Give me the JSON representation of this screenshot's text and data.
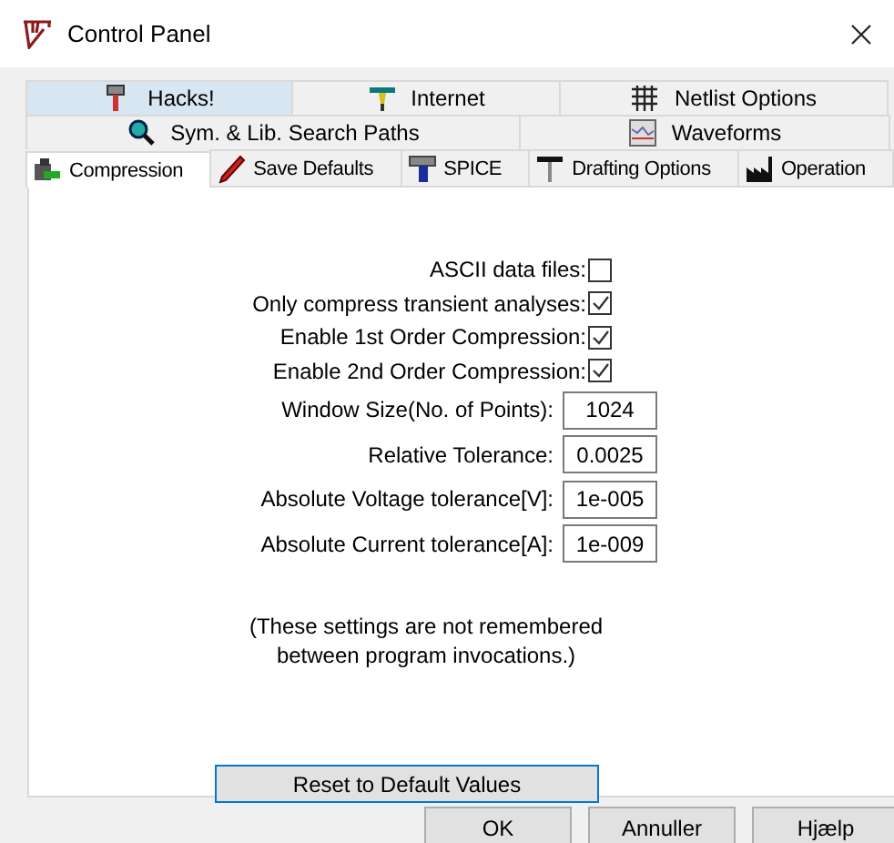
{
  "window": {
    "title": "Control Panel"
  },
  "tab_rows": [
    [
      {
        "label": "Hacks!",
        "selected": false,
        "highlighted": true
      },
      {
        "label": "Internet",
        "selected": false,
        "highlighted": false
      },
      {
        "label": "Netlist Options",
        "selected": false,
        "highlighted": false
      }
    ],
    [
      {
        "label": "Sym. & Lib. Search Paths",
        "selected": false,
        "highlighted": false
      },
      {
        "label": "Waveforms",
        "selected": false,
        "highlighted": false
      }
    ],
    [
      {
        "label": "Compression",
        "selected": true,
        "highlighted": false
      },
      {
        "label": "Save Defaults",
        "selected": false,
        "highlighted": false
      },
      {
        "label": "SPICE",
        "selected": false,
        "highlighted": false
      },
      {
        "label": "Drafting Options",
        "selected": false,
        "highlighted": false
      },
      {
        "label": "Operation",
        "selected": false,
        "highlighted": false
      }
    ]
  ],
  "form": {
    "rows": [
      {
        "kind": "checkbox",
        "label": "ASCII data files:",
        "checked": false
      },
      {
        "kind": "checkbox",
        "label": "Only compress transient analyses:",
        "checked": true
      },
      {
        "kind": "checkbox",
        "label": "Enable 1st Order Compression:",
        "checked": true
      },
      {
        "kind": "checkbox",
        "label": "Enable 2nd Order Compression:",
        "checked": true
      },
      {
        "kind": "field",
        "label": "Window Size(No. of Points):",
        "value": "1024"
      },
      {
        "kind": "field",
        "label": "Relative Tolerance:",
        "value": "0.0025"
      },
      {
        "kind": "field",
        "label": "Absolute Voltage tolerance[V]:",
        "value": "1e-005"
      },
      {
        "kind": "field",
        "label": "Absolute Current tolerance[A]:",
        "value": "1e-009"
      }
    ],
    "note": [
      "(These settings are not remembered",
      "between program invocations.)"
    ],
    "reset_button": "Reset to Default Values"
  },
  "buttons": [
    "OK",
    "Annuller",
    "Hjælp"
  ]
}
